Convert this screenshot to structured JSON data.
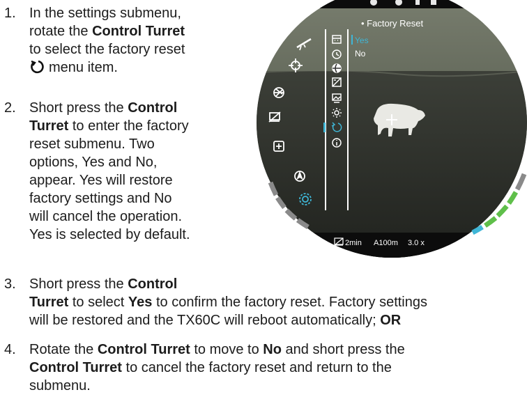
{
  "steps": [
    {
      "num": "1.",
      "lines": [
        [
          {
            "t": "In the settings submenu,"
          }
        ],
        [
          {
            "t": "rotate the "
          },
          {
            "t": "Control Turret",
            "b": true
          }
        ],
        [
          {
            "t": "to select the factory reset"
          }
        ],
        [
          {
            "icon": "reset-icon"
          },
          {
            "t": "menu item."
          }
        ]
      ]
    },
    {
      "num": "2.",
      "lines": [
        [
          {
            "t": "Short press the "
          },
          {
            "t": "Control",
            "b": true
          }
        ],
        [
          {
            "t": "Turret",
            "b": true
          },
          {
            "t": " to enter the factory"
          }
        ],
        [
          {
            "t": "reset submenu. Two"
          }
        ],
        [
          {
            "t": "options, Yes and No,"
          }
        ],
        [
          {
            "t": "appear. Yes will restore"
          }
        ],
        [
          {
            "t": "factory settings and No"
          }
        ],
        [
          {
            "t": "will cancel the operation."
          }
        ],
        [
          {
            "t": "Yes is selected by default."
          }
        ]
      ]
    },
    {
      "num": "3.",
      "lines": [
        [
          {
            "t": "Short press the "
          },
          {
            "t": "Control",
            "b": true
          }
        ],
        [
          {
            "t": "Turret",
            "b": true
          },
          {
            "t": " to select "
          },
          {
            "t": "Yes",
            "b": true
          },
          {
            "t": " to confirm the factory reset. Factory settings"
          }
        ],
        [
          {
            "t": "will be restored and the TX60C will reboot automatically; "
          },
          {
            "t": "OR",
            "b": true
          }
        ]
      ]
    },
    {
      "num": "4.",
      "lines": [
        [
          {
            "t": "Rotate the "
          },
          {
            "t": "Control Turret",
            "b": true
          },
          {
            "t": " to move to "
          },
          {
            "t": "No",
            "b": true
          },
          {
            "t": " and short press the"
          }
        ],
        [
          {
            "t": "Control Turret",
            "b": true
          },
          {
            "t": " to cancel the factory reset and return to the"
          }
        ],
        [
          {
            "t": "submenu."
          }
        ]
      ]
    }
  ],
  "scope": {
    "submenu_title": "• Factory Reset",
    "option_yes": "Yes",
    "option_no": "No",
    "status_timer": "2min",
    "status_range": "A100m",
    "status_zoom": "3.0 x",
    "left_icons": [
      "rifle-icon",
      "crosshair-icon",
      "aperture-icon",
      "display-off-icon",
      "plus-box-icon",
      "compass-icon",
      "settings-gear-icon"
    ],
    "menu_icons": [
      "calendar-icon",
      "clock-icon",
      "globe-icon",
      "calibration-icon",
      "picture-icon",
      "brightness-icon",
      "reset-icon",
      "info-icon"
    ],
    "colors": {
      "accent": "#3fb6d6",
      "battery": "#5fbf4a",
      "text": "#ffffff"
    }
  }
}
